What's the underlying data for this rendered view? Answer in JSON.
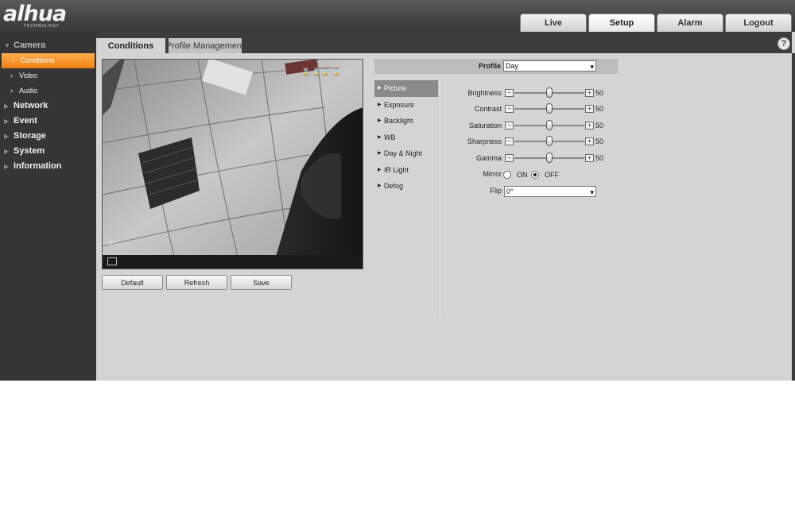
{
  "brand": {
    "name": "alhua",
    "sub": "TECHNOLOGY"
  },
  "top_tabs": [
    {
      "label": "Live"
    },
    {
      "label": "Setup"
    },
    {
      "label": "Alarm"
    },
    {
      "label": "Logout"
    }
  ],
  "sidebar": {
    "camera": "Camera",
    "camera_items": [
      "Conditions",
      "Video",
      "Audio"
    ],
    "sections": [
      "Network",
      "Event",
      "Storage",
      "System",
      "Information"
    ]
  },
  "tabs": {
    "conditions": "Conditions",
    "profile": "Profile Management",
    "help": "?"
  },
  "video": {
    "overlay": "IPC"
  },
  "buttons": {
    "default": "Default",
    "refresh": "Refresh",
    "save": "Save"
  },
  "profile": {
    "label": "Profile",
    "value": "Day"
  },
  "sub_nav": [
    "Picture",
    "Exposure",
    "Backlight",
    "WB",
    "Day & Night",
    "IR Light",
    "Defog"
  ],
  "picture": {
    "sliders": [
      {
        "label": "Brightness",
        "value": 50
      },
      {
        "label": "Contrast",
        "value": 50
      },
      {
        "label": "Saturation",
        "value": 50
      },
      {
        "label": "Sharpness",
        "value": 50
      },
      {
        "label": "Gamma",
        "value": 50
      }
    ],
    "mirror": {
      "label": "Mirror",
      "on": "ON",
      "off": "OFF",
      "selected": "OFF"
    },
    "flip": {
      "label": "Flip",
      "value": "0°"
    }
  }
}
